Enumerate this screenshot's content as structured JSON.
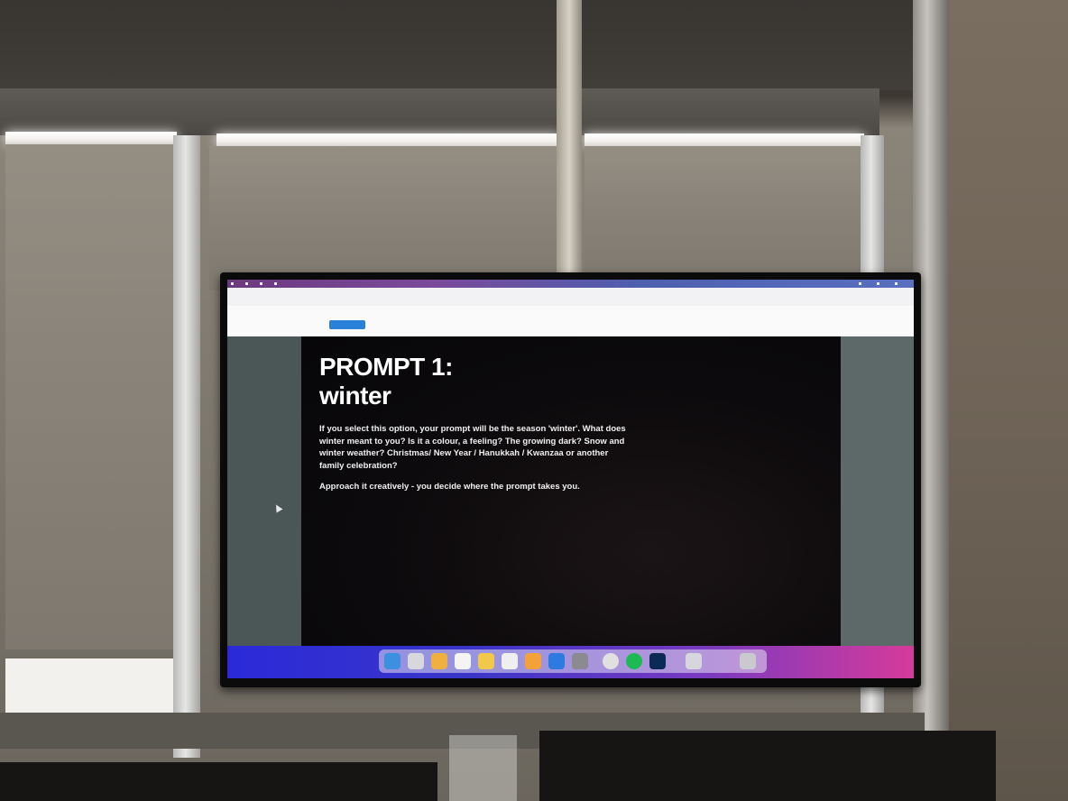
{
  "slide": {
    "title_line1": "PROMPT 1:",
    "title_line2": "winter",
    "paragraph1": "If you select this option, your prompt will be the season 'winter'. What does winter meant to you? Is it a colour, a feeling? The growing dark? Snow and winter weather? Christmas/ New Year / Hanukkah / Kwanzaa or another family celebration?",
    "paragraph2": "Approach it creatively - you decide where the prompt takes you."
  },
  "colors": {
    "slide_background": "#0c0a0c",
    "slide_text": "#ffffff",
    "side_panel": "#4b5657",
    "dock_gradient_start": "#2a2ad8",
    "dock_gradient_end": "#d63a9a",
    "button_blue": "#2a7fd8"
  },
  "dock_icons": [
    "finder-icon",
    "launchpad-icon",
    "photos-icon",
    "calendar-icon",
    "notes-icon",
    "reminders-icon",
    "pages-icon",
    "app-store-icon",
    "settings-icon",
    "chrome-icon",
    "spotify-icon",
    "photoshop-icon",
    "folder-icon",
    "trash-icon"
  ]
}
